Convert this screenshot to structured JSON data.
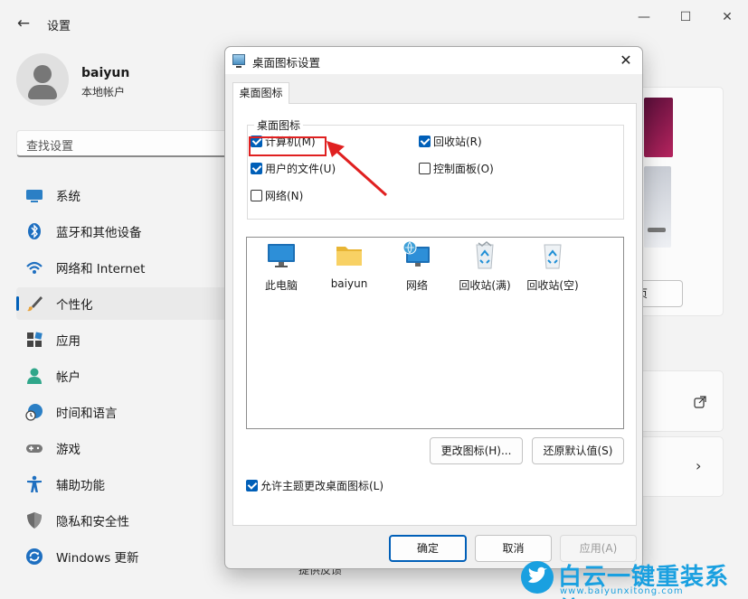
{
  "settings": {
    "title": "设置",
    "user": {
      "name": "baiyun",
      "type": "本地帐户"
    },
    "search_placeholder": "查找设置",
    "nav": [
      {
        "label": "系统",
        "icon": "monitor-icon"
      },
      {
        "label": "蓝牙和其他设备",
        "icon": "bluetooth-icon"
      },
      {
        "label": "网络和 Internet",
        "icon": "wifi-icon"
      },
      {
        "label": "个性化",
        "icon": "brush-icon",
        "active": true
      },
      {
        "label": "应用",
        "icon": "apps-icon"
      },
      {
        "label": "帐户",
        "icon": "person-icon"
      },
      {
        "label": "时间和语言",
        "icon": "globe-clock-icon"
      },
      {
        "label": "游戏",
        "icon": "gamepad-icon"
      },
      {
        "label": "辅助功能",
        "icon": "accessibility-icon"
      },
      {
        "label": "隐私和安全性",
        "icon": "shield-icon"
      },
      {
        "label": "Windows 更新",
        "icon": "update-icon"
      }
    ],
    "right_button_fragment": "页"
  },
  "dialog": {
    "title": "桌面图标设置",
    "tab": "桌面图标",
    "group_label": "桌面图标",
    "checkboxes": [
      {
        "label": "计算机(M)",
        "checked": true
      },
      {
        "label": "回收站(R)",
        "checked": true
      },
      {
        "label": "用户的文件(U)",
        "checked": true
      },
      {
        "label": "控制面板(O)",
        "checked": false
      },
      {
        "label": "网络(N)",
        "checked": false
      }
    ],
    "icons": [
      {
        "label": "此电脑",
        "icon": "computer-icon"
      },
      {
        "label": "baiyun",
        "icon": "folder-icon"
      },
      {
        "label": "网络",
        "icon": "network-icon"
      },
      {
        "label": "回收站(满)",
        "icon": "recycle-bin-full-icon"
      },
      {
        "label": "回收站(空)",
        "icon": "recycle-bin-empty-icon"
      }
    ],
    "change_icon_btn": "更改图标(H)...",
    "restore_default_btn": "还原默认值(S)",
    "allow_themes": {
      "label": "允许主题更改桌面图标(L)",
      "checked": true
    },
    "ok_btn": "确定",
    "cancel_btn": "取消",
    "apply_btn": "应用(A)"
  },
  "bottom_peek": "提供反馈",
  "watermark": {
    "text": "白云一键重装系统",
    "url": "www.baiyunxitong.com"
  },
  "colors": {
    "accent": "#005fb8",
    "highlight": "#e02020",
    "watermark": "#1aa0e0"
  }
}
